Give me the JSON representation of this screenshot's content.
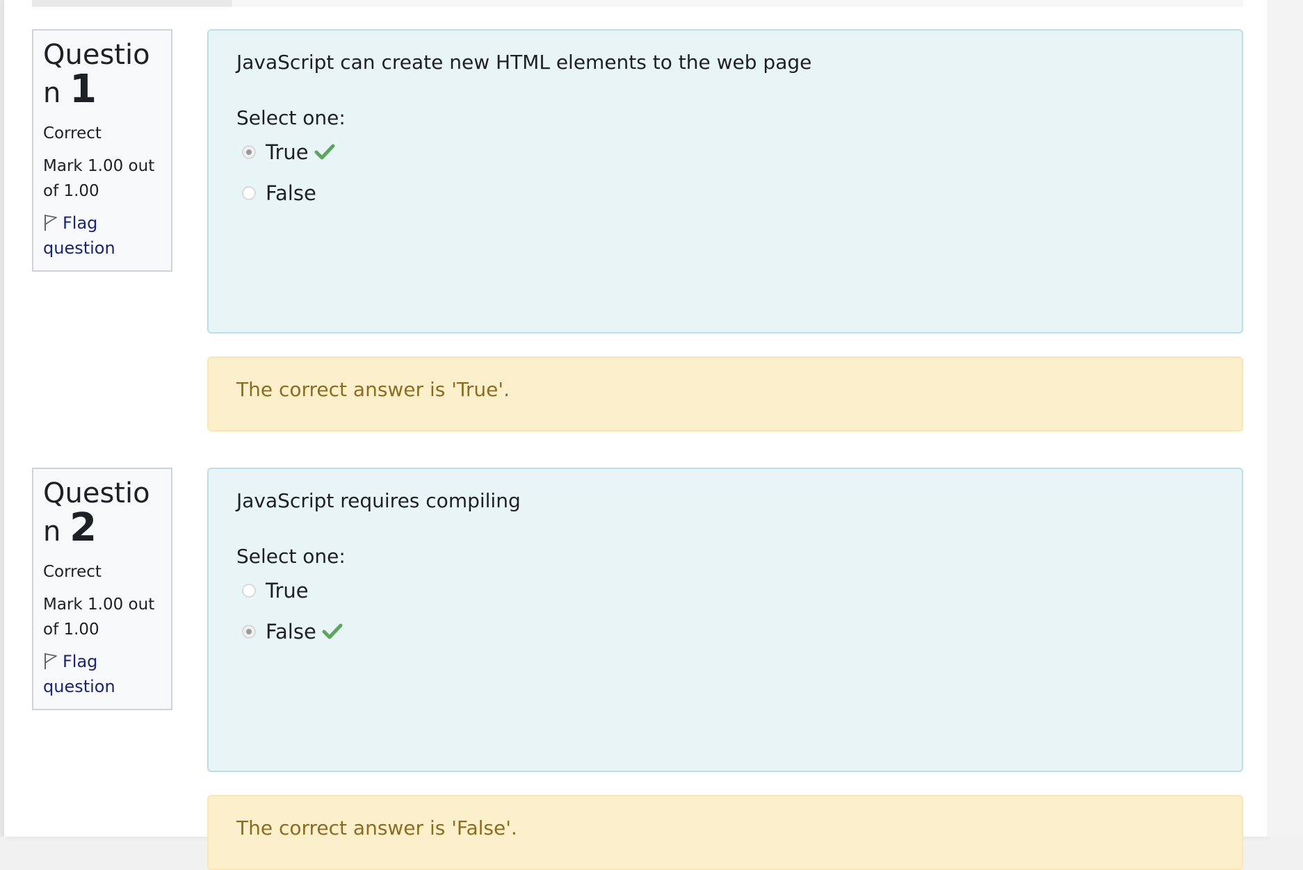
{
  "questions": [
    {
      "label": "Question",
      "number": "1",
      "state": "Correct",
      "grade": "Mark 1.00 out of 1.00",
      "flag_label": "Flag question",
      "text": "JavaScript can create new HTML elements to the web page",
      "prompt": "Select one:",
      "options": [
        {
          "label": "True",
          "selected": true,
          "marked_correct": true
        },
        {
          "label": "False",
          "selected": false,
          "marked_correct": false
        }
      ],
      "feedback": "The correct answer is 'True'."
    },
    {
      "label": "Question",
      "number": "2",
      "state": "Correct",
      "grade": "Mark 1.00 out of 1.00",
      "flag_label": "Flag question",
      "text": "JavaScript requires compiling",
      "prompt": "Select one:",
      "options": [
        {
          "label": "True",
          "selected": false,
          "marked_correct": false
        },
        {
          "label": "False",
          "selected": true,
          "marked_correct": true
        }
      ],
      "feedback": "The correct answer is 'False'."
    }
  ],
  "colors": {
    "formulation_bg": "#e9f4f6",
    "feedback_bg": "#fcefcb",
    "feedback_text": "#8a6d1f",
    "link": "#1a237e",
    "correct_check": "#5aa65a"
  },
  "icons": {
    "flag": "flag-icon",
    "correct": "check-icon"
  }
}
